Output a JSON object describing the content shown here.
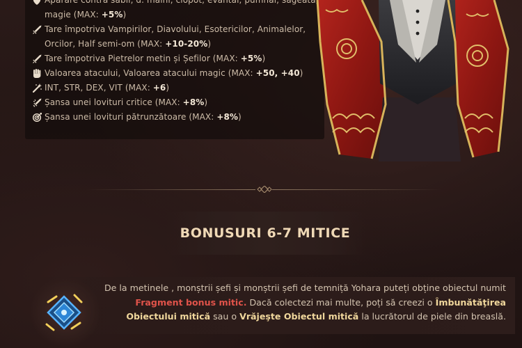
{
  "bonus_list": [
    {
      "icon": "shield-icon",
      "text": "Apărare contra săbii, d. mâini, clopot, evantai, pumnal, săgeată, magie (MAX: ",
      "max": "+5%",
      "suffix": ")"
    },
    {
      "icon": "sword-icon",
      "text": "Tare împotriva Vampirilor, Diavolului, Esotericilor, Animalelor, Orcilor, Half semi-om (MAX: ",
      "max": "+10-20%",
      "suffix": ")"
    },
    {
      "icon": "sword-icon",
      "text": "Tare împotriva Pietrelor metin și Șefilor (MAX: ",
      "max": "+5%",
      "suffix": ")"
    },
    {
      "icon": "fist-icon",
      "text": "Valoarea atacului, Valoarea atacului magic (MAX: ",
      "max": "+50, +40",
      "suffix": ")"
    },
    {
      "icon": "wand-icon",
      "text": "INT, STR, DEX, VIT (MAX: ",
      "max": "+6",
      "suffix": ")"
    },
    {
      "icon": "critical-hit-icon",
      "text": "Șansa unei lovituri critice (MAX: ",
      "max": "+8%",
      "suffix": ")"
    },
    {
      "icon": "target-icon",
      "text": "Șansa unei lovituri pătrunzătoare (MAX: ",
      "max": "+8%",
      "suffix": ")"
    }
  ],
  "section": {
    "title": "BONUSURI 6-7 MITICE"
  },
  "info": {
    "part1": "De la metinele , monștrii șefi și monștrii șefi de temniță Yohara puteți obține obiectul numit ",
    "fragment": "Fragment bonus mitic.",
    "part2": " Dacă colectezi mai multe, poți să creezi o ",
    "upgrade": "Îmbunătăţirea Obiectului mitică",
    "part3": " sau o ",
    "enchant": "Vrăjeşte Obiectul mitică",
    "part4": " la lucrătorul de piele din breaslă."
  },
  "colors": {
    "background": "#241615",
    "highlight_red": "#e0534a",
    "highlight_gold": "#f0d79c",
    "title": "#f0d9b6"
  }
}
